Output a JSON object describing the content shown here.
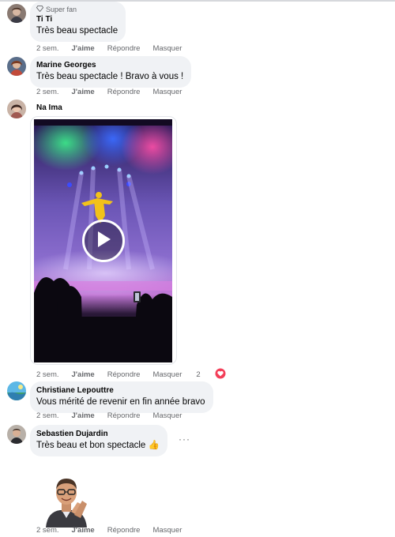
{
  "comments": [
    {
      "badge": "Super fan",
      "author": "Ti Ti",
      "text": "Très beau spectacle",
      "time": "2 sem.",
      "like_label": "J'aime",
      "reply_label": "Répondre",
      "hide_label": "Masquer"
    },
    {
      "author": "Marine Georges",
      "text": "Très beau spectacle ! Bravo à vous !",
      "time": "2 sem.",
      "like_label": "J'aime",
      "reply_label": "Répondre",
      "hide_label": "Masquer"
    },
    {
      "author": "Na Ima",
      "attachment": "video",
      "time": "2 sem.",
      "like_label": "J'aime",
      "reply_label": "Répondre",
      "hide_label": "Masquer",
      "reaction_count": "2",
      "reaction_icon": "heart-icon"
    },
    {
      "author": "Christiane Lepouttre",
      "text": "Vous mérité de revenir en fin année bravo",
      "time": "2 sem.",
      "like_label": "J'aime",
      "reply_label": "Répondre",
      "hide_label": "Masquer"
    },
    {
      "author": "Sebastien Dujardin",
      "text": "Très beau et bon spectacle 👍",
      "time": "2 sem.",
      "like_label": "J'aime",
      "reply_label": "Répondre",
      "hide_label": "Masquer",
      "more_label": "···"
    },
    {
      "attachment": "sticker",
      "time": "2 sem.",
      "like_label": "J'aime",
      "reply_label": "Répondre",
      "hide_label": "Masquer"
    }
  ],
  "colors": {
    "bubble": "#f0f2f5",
    "meta_text": "#65676b",
    "heart": "#f33e58"
  }
}
